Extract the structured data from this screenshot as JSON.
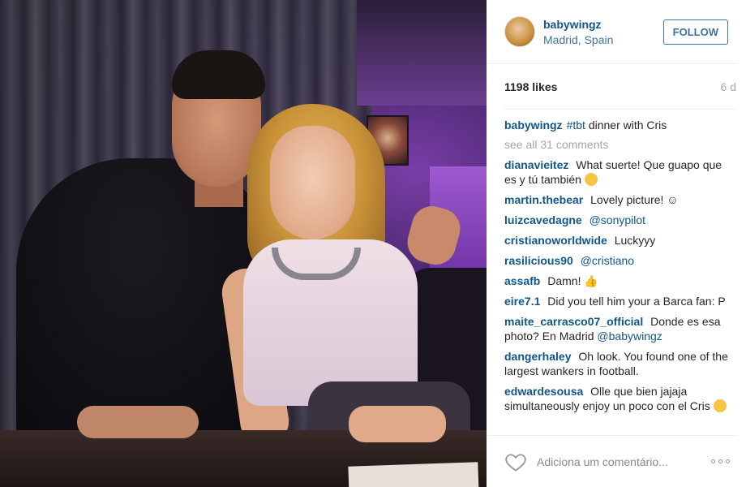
{
  "header": {
    "username": "babywingz",
    "location": "Madrid, Spain",
    "follow_label": "FOLLOW"
  },
  "stats": {
    "likes": "1198 likes",
    "age": "6 d"
  },
  "caption": {
    "user": "babywingz",
    "hashtag": "#tbt",
    "text": "dinner with Cris"
  },
  "see_all": "see all 31 comments",
  "comments": [
    {
      "user": "dianavieitez",
      "text": "What suerte! Que guapo que es y tú también",
      "emoji": "smile-emoji"
    },
    {
      "user": "martin.thebear",
      "text": "Lovely picture! ☺"
    },
    {
      "user": "luizcavedagne",
      "mention": "@sonypilot"
    },
    {
      "user": "cristianoworldwide",
      "text": "Luckyyy"
    },
    {
      "user": "rasilicious90",
      "mention": "@cristiano"
    },
    {
      "user": "assafb",
      "text": "Damn! 👍"
    },
    {
      "user": "eire7.1",
      "text": "Did you tell him your a Barca fan: P"
    },
    {
      "user": "maite_carrasco07_official",
      "text": "Donde es esa photo? En Madrid",
      "mention": "@babywingz"
    },
    {
      "user": "dangerhaley",
      "text": "Oh look. You found one of the largest wankers in football."
    },
    {
      "user": "edwardesousa",
      "text": "Olle que bien jajaja simultaneously enjoy un poco con el Cris",
      "emoji": "flex-laugh-emoji"
    }
  ],
  "footer": {
    "comment_placeholder": "Adiciona um comentário...",
    "like_icon": "heart-outline-icon",
    "more_icon": "more-dots-icon"
  },
  "colors": {
    "username_blue": "#125688",
    "follow_blue": "#3f729b",
    "muted": "#a5a7aa"
  }
}
